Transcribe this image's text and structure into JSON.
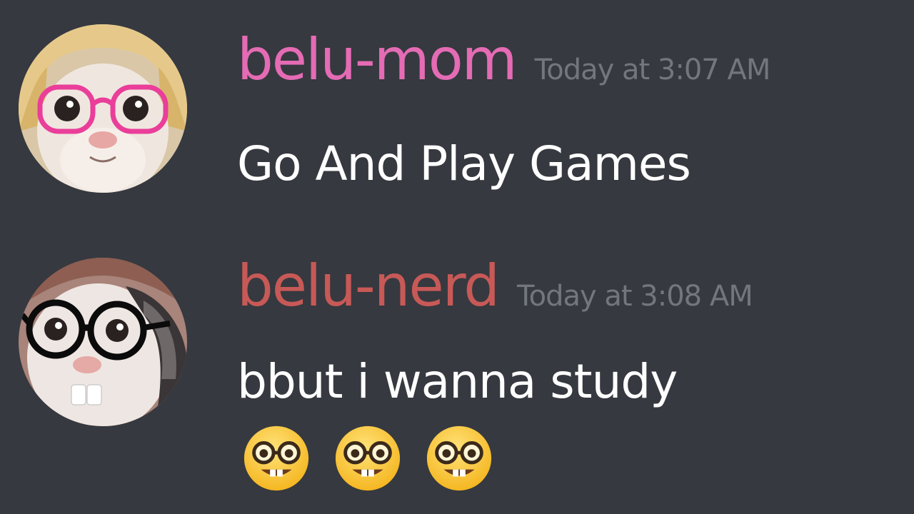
{
  "messages": [
    {
      "author": "belu-mom",
      "author_color": "#e46bb4",
      "timestamp": "Today at 3:07 AM",
      "text": "Go And Play Games",
      "avatar_icon": "cat-with-pink-glasses-avatar"
    },
    {
      "author": "belu-nerd",
      "author_color": "#c75957",
      "timestamp": "Today at 3:08 AM",
      "text": "bbut i wanna study",
      "avatar_icon": "cat-with-black-glasses-avatar",
      "emojis": [
        "nerd-face-emoji",
        "nerd-face-emoji",
        "nerd-face-emoji"
      ]
    }
  ],
  "colors": {
    "background": "#36393f",
    "timestamp": "#72767d",
    "message_text": "#ffffff"
  }
}
